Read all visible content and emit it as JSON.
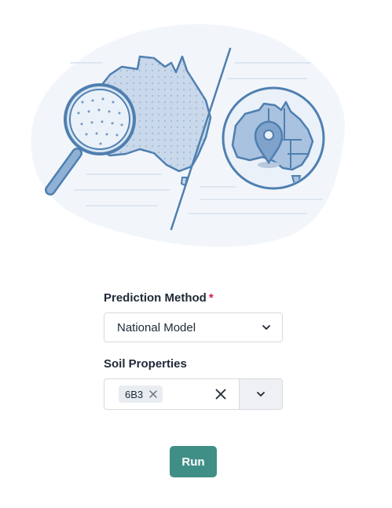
{
  "form": {
    "method": {
      "label": "Prediction Method",
      "required_mark": "*",
      "value": "National Model"
    },
    "soil": {
      "label": "Soil Properties",
      "tags": [
        "6B3"
      ]
    }
  },
  "actions": {
    "run_label": "Run"
  },
  "colors": {
    "accent": "#3f8f86",
    "required": "#e11d48",
    "illustration_blue": "#4f7fb0"
  },
  "icons": [
    "magnifying-glass-icon",
    "australia-map-icon",
    "location-pin-icon",
    "chevron-down-icon",
    "close-icon"
  ]
}
